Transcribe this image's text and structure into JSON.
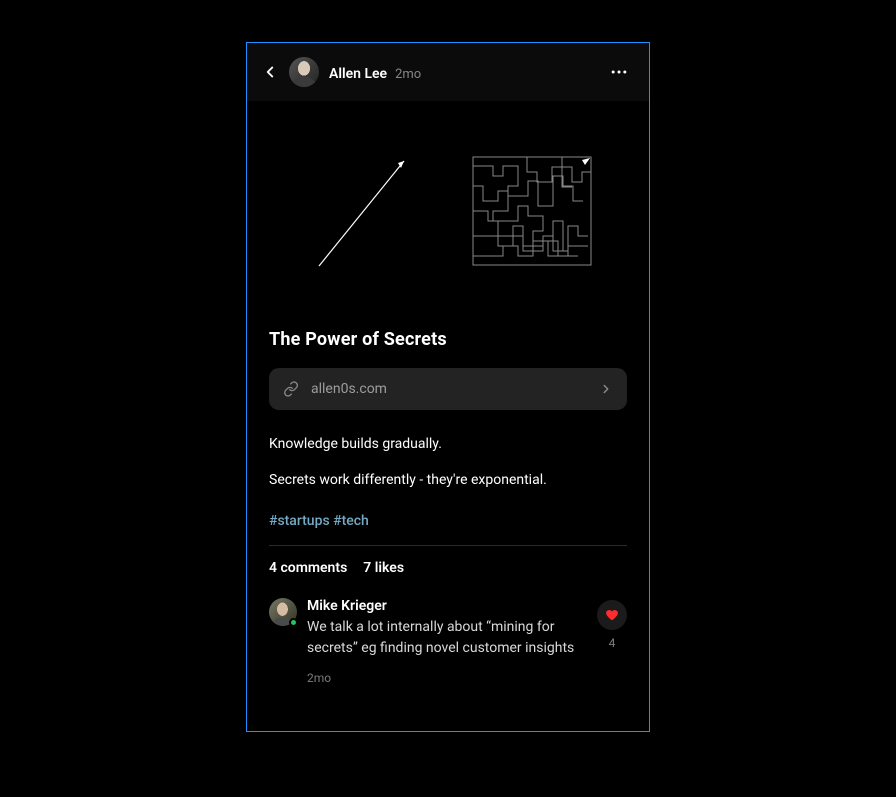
{
  "header": {
    "author": "Allen Lee",
    "timestamp": "2mo"
  },
  "post": {
    "title": "The Power of Secrets",
    "link_url": "allen0s.com",
    "paragraphs": [
      "Knowledge builds gradually.",
      "Secrets work differently - they're exponential."
    ],
    "tags": "#startups #tech"
  },
  "stats": {
    "comments": "4 comments",
    "likes": "7 likes"
  },
  "comment": {
    "author": "Mike Krieger",
    "text": "We talk a lot internally about “mining for secrets” eg finding novel customer insights",
    "timestamp": "2mo",
    "like_count": "4"
  },
  "colors": {
    "accent_border": "#1e90ff",
    "heart": "#ff2d2d"
  }
}
